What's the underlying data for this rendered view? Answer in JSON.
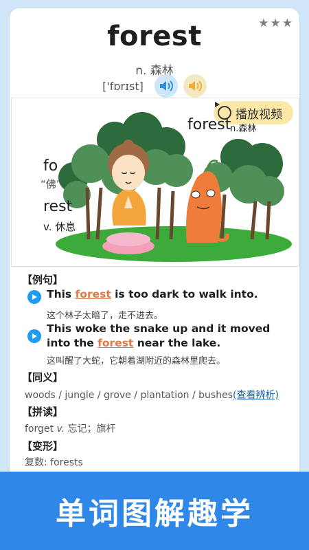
{
  "rating": {
    "stars": 3
  },
  "word": "forest",
  "part_of_speech": "n. 森林",
  "phonetic": "['fɒrɪst]",
  "speakers": [
    "speaker-icon",
    "speaker-icon"
  ],
  "illustration": {
    "video_label": "播放视频",
    "word": "forest",
    "pos": "n.森林",
    "part1": "fo",
    "part1_hint": "“佛”",
    "part2": "rest",
    "part2_meaning": "v. 休息"
  },
  "examples": {
    "title": "【例句】",
    "items": [
      {
        "before": "This ",
        "highlight": "forest",
        "after": " is too dark to walk into.",
        "translation": "这个林子太暗了，走不进去。"
      },
      {
        "before": "This woke the snake up and it moved into the ",
        "highlight": "forest",
        "after": " near the lake.",
        "translation": "这叫醒了大蛇，它朝着湖附近的森林里爬去。"
      }
    ]
  },
  "synonyms": {
    "title": "【同义】",
    "text": "woods / jungle / grove / plantation / bushes",
    "link": "(查看辨析)"
  },
  "spelling": {
    "title": "【拼读】",
    "word": "forget",
    "pos": "v.",
    "meaning": "忘记；旗杆"
  },
  "forms": {
    "title": "【变形】",
    "text": "复数: forests"
  },
  "banner": "单词图解趣学"
}
